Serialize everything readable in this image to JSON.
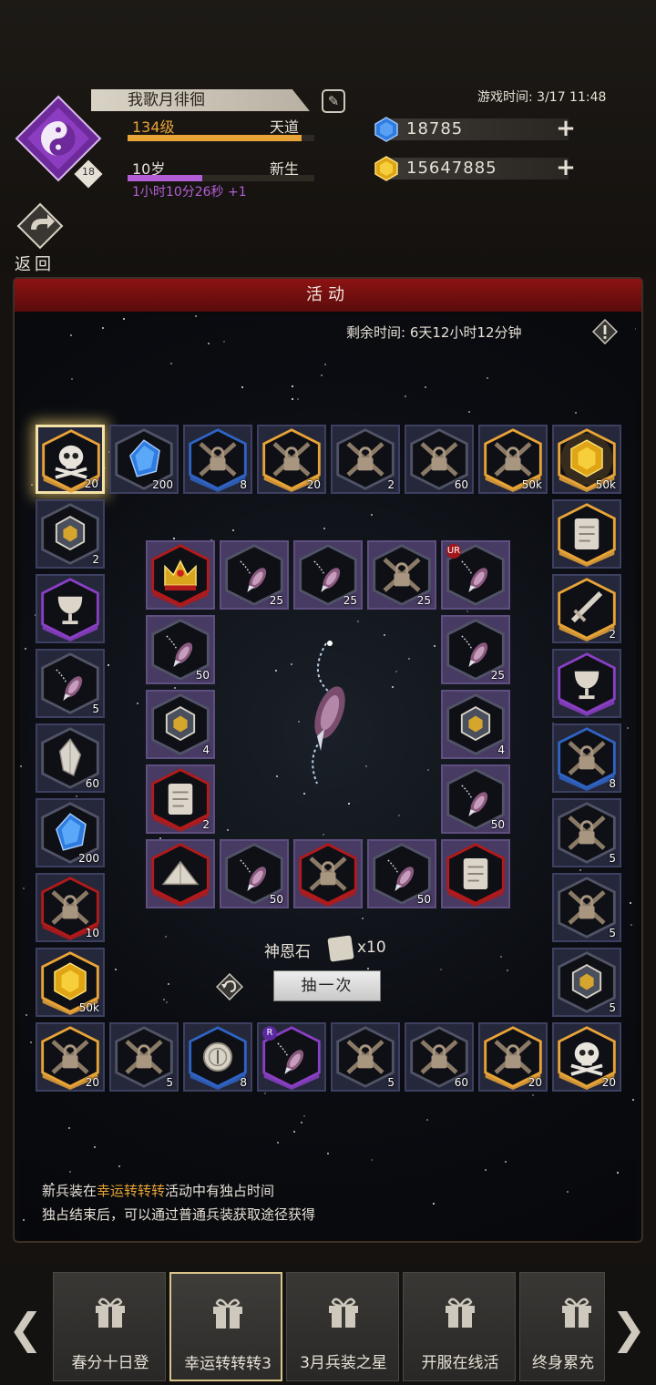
{
  "player": {
    "name": "我歌月徘徊",
    "level": "134级",
    "realm": "天道",
    "age": "10岁",
    "stage": "新生",
    "timer": "1小时10分26秒 +1",
    "avatar_badge": "18",
    "level_progress": 0.93,
    "age_progress": 0.4,
    "colors": {
      "level_bar": "#e9a437",
      "age_bar": "#b35ed6"
    }
  },
  "game_time": "游戏时间: 3/17 11:48",
  "currency": {
    "gems": "18785",
    "gold": "15647885"
  },
  "back_label": "返回",
  "panel": {
    "title": "活动",
    "remaining": "剩余时间: 6天12小时12分钟",
    "god_stone_label": "神恩石",
    "god_stone_count": "x10",
    "draw_button": "抽一次",
    "note_prefix": "新兵装在",
    "note_highlight": "幸运转转转",
    "note_suffix": "活动中有独占时间",
    "note2": "独占结束后，可以通过普通兵装获取途径获得"
  },
  "board": {
    "outer": [
      {
        "icon": "skull-icon",
        "count": "20",
        "rim": "gold",
        "selected": true
      },
      {
        "icon": "blue-gem-icon",
        "count": "200",
        "rim": "none"
      },
      {
        "icon": "locked-icon",
        "count": "8",
        "rim": "blue"
      },
      {
        "icon": "locked-icon",
        "count": "20",
        "rim": "gold"
      },
      {
        "icon": "locked-icon",
        "count": "2",
        "rim": "none"
      },
      {
        "icon": "locked-icon",
        "count": "60",
        "rim": "none"
      },
      {
        "icon": "locked-icon",
        "count": "50k",
        "rim": "gold"
      },
      {
        "icon": "gold-gem-icon",
        "count": "50k",
        "rim": "gold",
        "glow": true
      },
      {
        "icon": "scroll-icon",
        "count": "",
        "rim": "gold"
      },
      {
        "icon": "sword-icon",
        "count": "2",
        "rim": "gold"
      },
      {
        "icon": "chalice-icon",
        "count": "",
        "rim": "purple"
      },
      {
        "icon": "locked-icon",
        "count": "8",
        "rim": "blue"
      },
      {
        "icon": "locked-icon",
        "count": "5",
        "rim": "none"
      },
      {
        "icon": "locked-icon",
        "count": "5",
        "rim": "none"
      },
      {
        "icon": "cube-icon",
        "count": "5",
        "rim": "none"
      },
      {
        "icon": "skull-icon",
        "count": "20",
        "rim": "gold"
      },
      {
        "icon": "locked-icon",
        "count": "20",
        "rim": "gold"
      },
      {
        "icon": "locked-icon",
        "count": "60",
        "rim": "none"
      },
      {
        "icon": "locked-icon",
        "count": "5",
        "rim": "none"
      },
      {
        "icon": "pendant-icon",
        "count": "",
        "rim": "purple",
        "badge": "R"
      },
      {
        "icon": "compass-icon",
        "count": "8",
        "rim": "blue"
      },
      {
        "icon": "locked-icon",
        "count": "5",
        "rim": "none"
      },
      {
        "icon": "locked-icon",
        "count": "20",
        "rim": "gold"
      },
      {
        "icon": "gold-gem-icon",
        "count": "50k",
        "rim": "gold"
      },
      {
        "icon": "locked-icon",
        "count": "10",
        "rim": "red"
      },
      {
        "icon": "blue-gem-icon",
        "count": "200",
        "rim": "none"
      },
      {
        "icon": "crystal-icon",
        "count": "60",
        "rim": "none"
      },
      {
        "icon": "pendant-icon",
        "count": "5",
        "rim": "none"
      },
      {
        "icon": "chalice-icon",
        "count": "",
        "rim": "purple"
      },
      {
        "icon": "cube-icon",
        "count": "2",
        "rim": "none"
      }
    ],
    "inner": [
      {
        "icon": "crown-icon",
        "count": "",
        "rim": "red"
      },
      {
        "icon": "pendant-icon",
        "count": "25",
        "rim": "none"
      },
      {
        "icon": "pendant-icon",
        "count": "25",
        "rim": "none"
      },
      {
        "icon": "locked-icon",
        "count": "25",
        "rim": "none"
      },
      {
        "icon": "pendant-icon",
        "count": "",
        "rim": "none",
        "badge": "UR"
      },
      {
        "icon": "pendant-icon",
        "count": "25",
        "rim": "none"
      },
      {
        "icon": "cube-icon",
        "count": "4",
        "rim": "none"
      },
      {
        "icon": "pendant-icon",
        "count": "50",
        "rim": "none"
      },
      {
        "icon": "scroll-icon",
        "count": "",
        "rim": "red"
      },
      {
        "icon": "pendant-icon",
        "count": "50",
        "rim": "none"
      },
      {
        "icon": "locked-icon",
        "count": "",
        "rim": "red"
      },
      {
        "icon": "pendant-icon",
        "count": "50",
        "rim": "none"
      },
      {
        "icon": "pyramid-icon",
        "count": "",
        "rim": "red"
      },
      {
        "icon": "scroll-icon",
        "count": "2",
        "rim": "red"
      },
      {
        "icon": "cube-icon",
        "count": "4",
        "rim": "none"
      },
      {
        "icon": "pendant-icon",
        "count": "50",
        "rim": "none"
      }
    ]
  },
  "tabs": [
    {
      "label": "春分十日登"
    },
    {
      "label": "幸运转转转3",
      "active": true
    },
    {
      "label": "3月兵装之星"
    },
    {
      "label": "开服在线活"
    },
    {
      "label": "终身累充"
    }
  ],
  "colors": {
    "gold": "#e9a437",
    "purple": "#8a3fc4",
    "blue": "#2f64c4",
    "red": "#b31a1a",
    "panel_title": "#8d1212",
    "inner_tile": "#473a63",
    "outer_tile": "#25273a"
  }
}
